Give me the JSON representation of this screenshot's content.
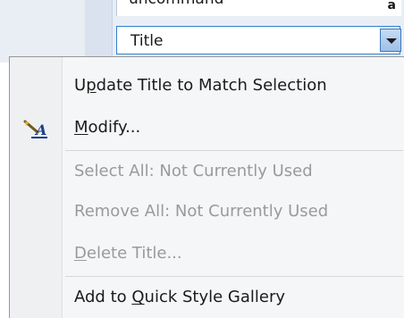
{
  "styles_pane": {
    "prev_item": "uncommand",
    "selected_item": "Title"
  },
  "menu": {
    "items": [
      {
        "before": "U",
        "ul": "p",
        "after": "date Title to Match Selection",
        "enabled": true
      },
      {
        "before": "",
        "ul": "M",
        "after": "odify...",
        "enabled": true,
        "icon": "modify-style-icon"
      },
      {
        "before": "Select All: Not Currently Used",
        "ul": "",
        "after": "",
        "enabled": false
      },
      {
        "before": "Remove All: Not Currently Used",
        "ul": "",
        "after": "",
        "enabled": false
      },
      {
        "before": "",
        "ul": "D",
        "after": "elete Title...",
        "enabled": false
      },
      {
        "before": "Add to ",
        "ul": "Q",
        "after": "uick Style Gallery",
        "enabled": true
      }
    ]
  },
  "colors": {
    "selection_border": "#2f7fd1",
    "disabled_text": "#9a9a9a"
  }
}
